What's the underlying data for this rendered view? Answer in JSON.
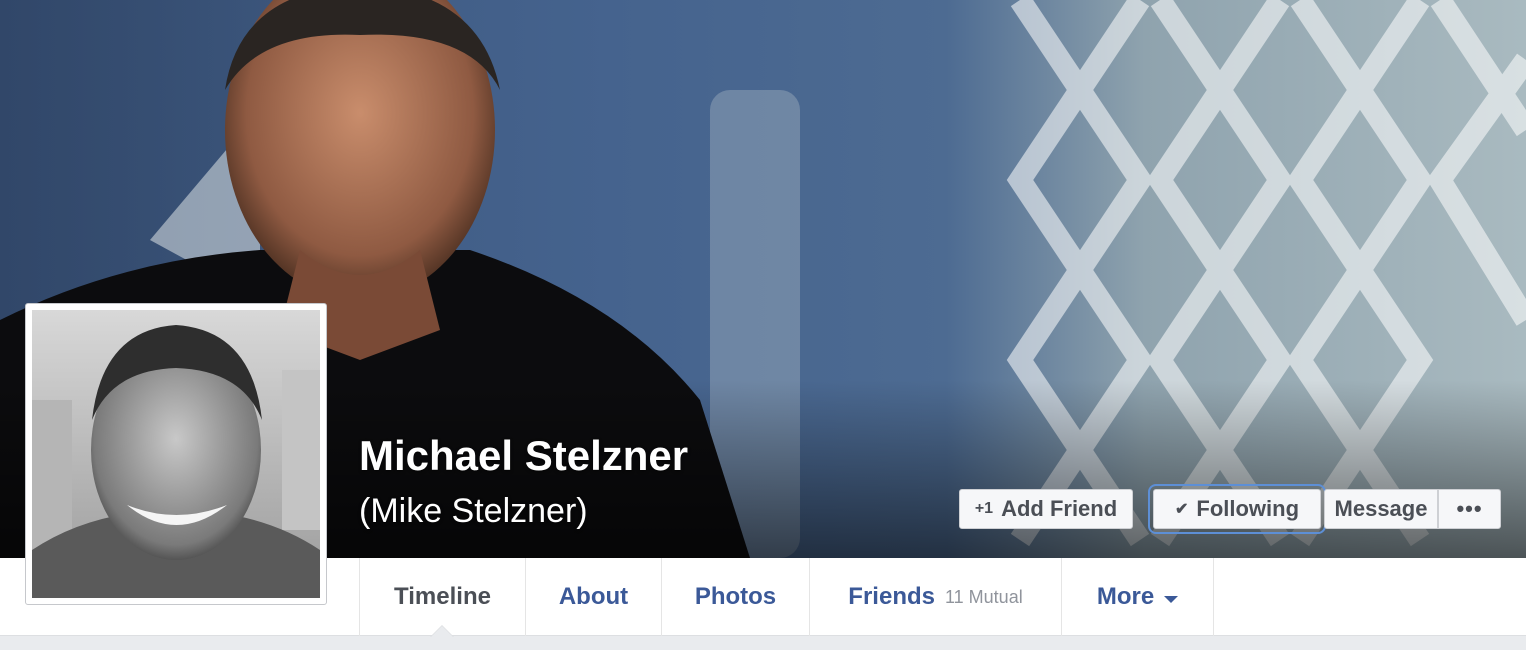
{
  "profile": {
    "name": "Michael Stelzner",
    "alternate_name": "(Mike Stelzner)"
  },
  "actions": {
    "add_friend": {
      "label": "Add Friend",
      "icon": "add-friend-icon"
    },
    "following": {
      "label": "Following",
      "icon": "checkmark-icon"
    },
    "message": {
      "label": "Message"
    },
    "more": {
      "label": "•••",
      "icon": "ellipsis-icon"
    }
  },
  "nav": {
    "tabs": [
      {
        "label": "Timeline",
        "active": true
      },
      {
        "label": "About"
      },
      {
        "label": "Photos"
      },
      {
        "label": "Friends",
        "sub": "11 Mutual"
      },
      {
        "label": "More",
        "icon": "caret-down-icon"
      }
    ]
  },
  "colors": {
    "link_blue": "#3b5998",
    "active_tab": "#4b4f56",
    "focus_outline": "#5d8fd6"
  }
}
